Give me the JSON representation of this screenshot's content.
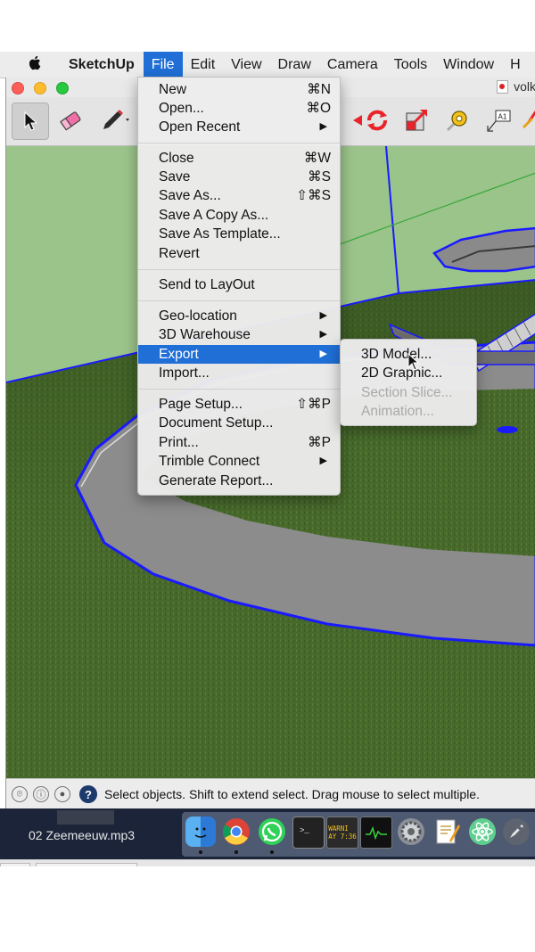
{
  "menubar": {
    "app_name": "SketchUp",
    "items": [
      "File",
      "Edit",
      "View",
      "Draw",
      "Camera",
      "Tools",
      "Window",
      "H"
    ]
  },
  "window": {
    "doc_title": "volk"
  },
  "file_menu": {
    "items": [
      {
        "label": "New",
        "shortcut": "⌘N"
      },
      {
        "label": "Open...",
        "shortcut": "⌘O"
      },
      {
        "label": "Open Recent",
        "shortcut": "▶"
      },
      {
        "label": "Close",
        "shortcut": "⌘W"
      },
      {
        "label": "Save",
        "shortcut": "⌘S"
      },
      {
        "label": "Save As...",
        "shortcut": "⇧⌘S"
      },
      {
        "label": "Save A Copy As...",
        "shortcut": ""
      },
      {
        "label": "Save As Template...",
        "shortcut": ""
      },
      {
        "label": "Revert",
        "shortcut": ""
      },
      {
        "label": "Send to LayOut",
        "shortcut": ""
      },
      {
        "label": "Geo-location",
        "shortcut": "▶"
      },
      {
        "label": "3D Warehouse",
        "shortcut": "▶"
      },
      {
        "label": "Export",
        "shortcut": "▶"
      },
      {
        "label": "Import...",
        "shortcut": ""
      },
      {
        "label": "Page Setup...",
        "shortcut": "⇧⌘P"
      },
      {
        "label": "Document Setup...",
        "shortcut": ""
      },
      {
        "label": "Print...",
        "shortcut": "⌘P"
      },
      {
        "label": "Trimble Connect",
        "shortcut": "▶"
      },
      {
        "label": "Generate Report...",
        "shortcut": ""
      }
    ]
  },
  "export_submenu": {
    "items": [
      "3D Model...",
      "2D Graphic...",
      "Section Slice...",
      "Animation..."
    ]
  },
  "statusbar": {
    "message": "Select objects. Shift to extend select. Drag mouse to select multiple.",
    "help_glyph": "?"
  },
  "dock": {
    "now_playing": "02 Zeemeeuw.mp3",
    "console_text": "WARNI\nAY 7:36"
  },
  "colors": {
    "accent": "#1f6fd6",
    "grass": "#4a6b2e",
    "road": "#8c8c8c",
    "sky": "#9bc48b",
    "selection": "#1a1aff"
  }
}
